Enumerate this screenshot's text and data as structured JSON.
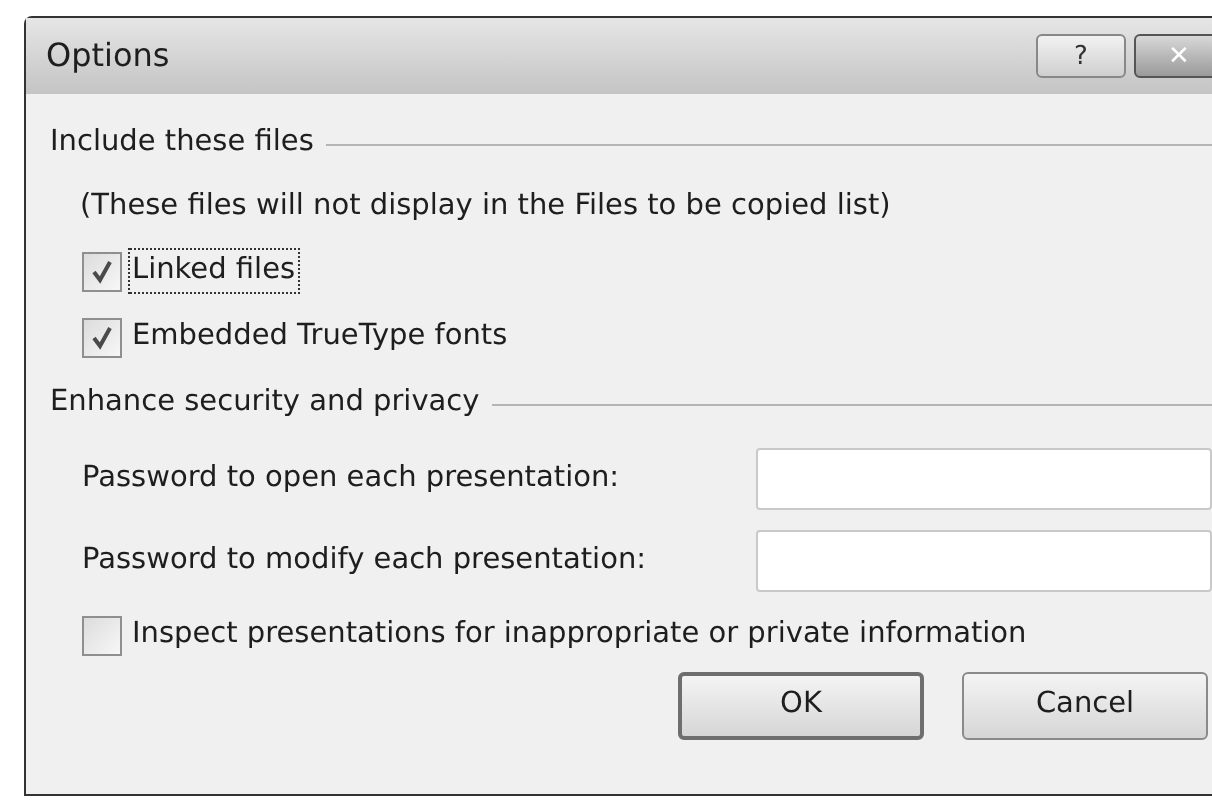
{
  "window": {
    "title": "Options",
    "help_button": "?",
    "close_button": "✕"
  },
  "sections": [
    {
      "title": "Include these files",
      "items": [
        {
          "kind": "note",
          "text": "(These files will not display in the Files to be copied list)"
        },
        {
          "kind": "checkbox",
          "label": "Linked files",
          "checked": true,
          "focused": true
        },
        {
          "kind": "checkbox",
          "label": "Embedded TrueType fonts",
          "checked": true,
          "focused": false
        }
      ]
    },
    {
      "title": "Enhance security and privacy",
      "items": [
        {
          "kind": "password",
          "label": "Password to open each presentation:"
        },
        {
          "kind": "password",
          "label": "Password to modify each presentation:"
        },
        {
          "kind": "checkbox",
          "label": "Inspect presentations for inappropriate or private information",
          "checked": false,
          "focused": false
        }
      ]
    }
  ],
  "buttons": [
    {
      "label": "OK",
      "default": true
    },
    {
      "label": "Cancel",
      "default": false
    }
  ]
}
